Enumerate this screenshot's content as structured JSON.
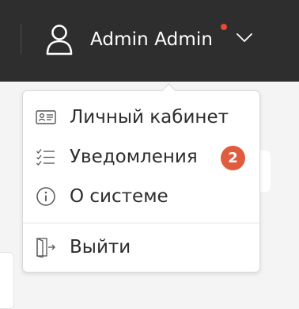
{
  "header": {
    "user_name": "Admin Admin",
    "has_unread_indicator": true,
    "icons": {
      "user": "user-icon",
      "chevron": "chevron-down-icon"
    }
  },
  "menu": {
    "items": [
      {
        "label": "Личный кабинет",
        "icon": "id-card-icon"
      },
      {
        "label": "Уведомления",
        "icon": "checklist-icon",
        "badge": "2"
      },
      {
        "label": "О системе",
        "icon": "info-circle-icon"
      },
      {
        "label": "Выйти",
        "icon": "logout-door-icon"
      }
    ]
  },
  "colors": {
    "topbar_bg": "#2e2e2e",
    "notification_dot": "#e8473b",
    "badge_bg": "#e15b3f",
    "menu_text": "#2d2d2d"
  }
}
